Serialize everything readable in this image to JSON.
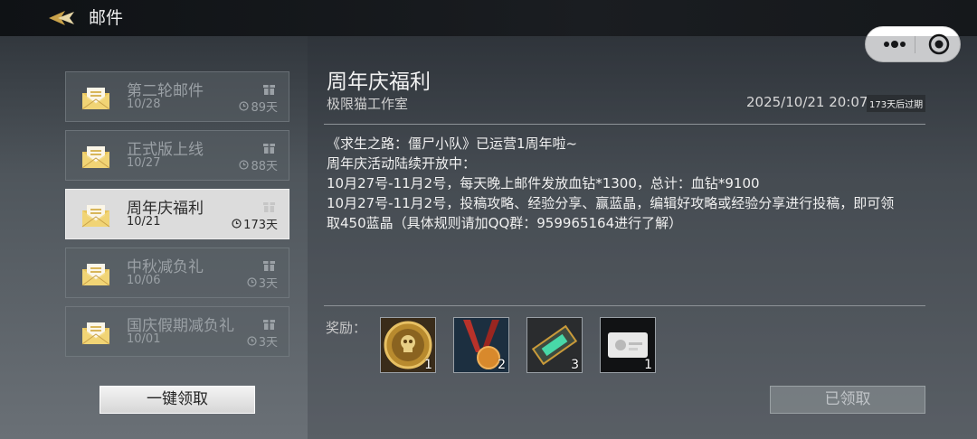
{
  "header": {
    "title": "邮件"
  },
  "mails": [
    {
      "title": "第二轮邮件",
      "date": "10/28",
      "days": "89天",
      "icon": "envelope-icon"
    },
    {
      "title": "正式版上线",
      "date": "10/27",
      "days": "88天",
      "icon": "envelope-icon"
    },
    {
      "title": "周年庆福利",
      "date": "10/21",
      "days": "173天",
      "icon": "envelope-icon",
      "selected": true
    },
    {
      "title": "中秋减负礼",
      "date": "10/06",
      "days": "3天",
      "icon": "envelope-icon"
    },
    {
      "title": "国庆假期减负礼",
      "date": "10/01",
      "days": "3天",
      "icon": "envelope-icon"
    }
  ],
  "claim_all_label": "一键领取",
  "detail": {
    "title": "周年庆福利",
    "sender": "极限猫工作室",
    "datetime": "2025/10/21 20:07",
    "expire": "173天后过期",
    "body": [
      "《求生之路：僵尸小队》已运营1周年啦~",
      "周年庆活动陆续开放中：",
      "10月27号-11月2号，每天晚上邮件发放血钻*1300，总计：血钻*9100",
      "10月27号-11月2号，投稿攻略、经验分享、赢蓝晶，编辑好攻略或经验分享进行投稿，即可领",
      "取450蓝晶（具体规则请加QQ群：959965164进行了解）"
    ],
    "rewards_label": "奖励：",
    "rewards": [
      {
        "icon": "gold-skull-coin-icon",
        "qty": "1"
      },
      {
        "icon": "medal-icon",
        "qty": "2"
      },
      {
        "icon": "ticket-icon",
        "qty": "3"
      },
      {
        "icon": "card-icon",
        "qty": "1"
      }
    ],
    "claimed_label": "已领取"
  },
  "colors": {
    "selected_bg": "#dcdcdc",
    "envelope_gold": "#e8c45a",
    "accent_gold": "#c9a24a"
  }
}
